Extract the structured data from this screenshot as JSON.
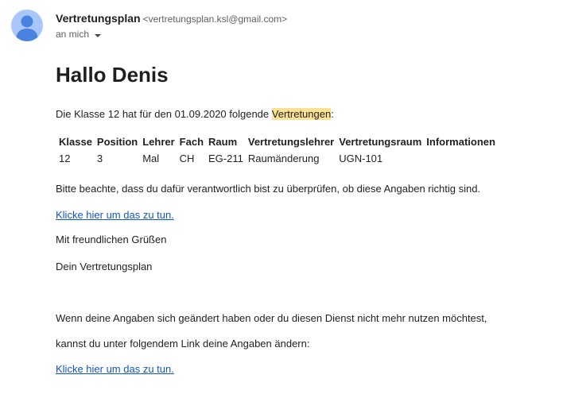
{
  "sender": {
    "name": "Vertretungsplan",
    "email": "<vertretungsplan.ksl@gmail.com>",
    "recipient": "an mich"
  },
  "message": {
    "greeting": "Hallo Denis",
    "intro_before": "Die Klasse 12 hat für den 01.09.2020 folgende ",
    "intro_highlight": "Vertretungen",
    "intro_after": ":",
    "table": {
      "headers": [
        "Klasse",
        "Position",
        "Lehrer",
        "Fach",
        "Raum",
        "Vertretungslehrer",
        "Vertretungsraum",
        "Informationen"
      ],
      "rows": [
        [
          "12",
          "3",
          "Mal",
          "CH",
          "EG-211",
          "Raumänderung",
          "UGN-101",
          ""
        ]
      ]
    },
    "check_text": "Bitte beachte, dass du dafür verantwortlich bist zu überprüfen, ob diese Angaben richtig sind.",
    "link1": "Klicke hier um das zu tun.",
    "closing": "Mit freundlichen Grüßen",
    "signature": "Dein Vertretungsplan",
    "change_text": "Wenn deine Angaben sich geändert haben oder du diesen Dienst nicht mehr nutzen möchtest,",
    "change_text2": "kannst du unter folgendem Link deine Angaben ändern:",
    "link2": "Klicke hier um das zu tun."
  },
  "colors": {
    "avatar": "#a8c7fa",
    "avatar_figure": "#4a82e0",
    "highlight": "#fde293",
    "link": "#1155cc"
  },
  "icons": {
    "avatar": "person-icon",
    "recipient_caret": "caret-down-icon"
  }
}
